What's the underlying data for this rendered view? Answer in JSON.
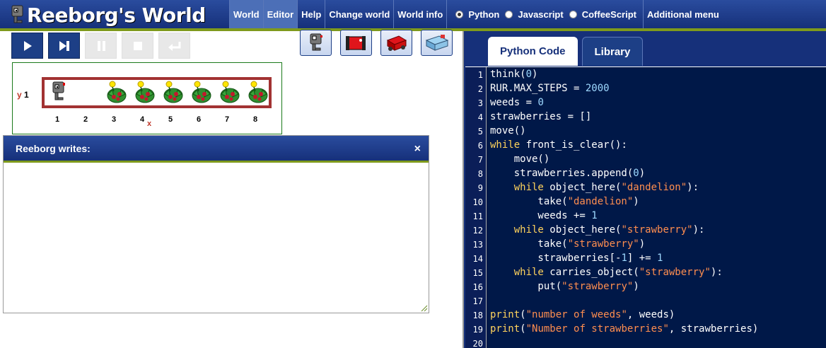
{
  "header": {
    "title": "Reeborg's World",
    "menu": [
      "World",
      "Editor",
      "Help",
      "Change world",
      "World info"
    ],
    "active_menu": [
      "World",
      "Editor"
    ],
    "languages": [
      "Python",
      "Javascript",
      "CoffeeScript"
    ],
    "selected_language": "Python",
    "additional_menu": "Additional menu"
  },
  "controls": {
    "run": "run-icon",
    "step": "step-icon",
    "pause": "pause-icon",
    "stop": "stop-icon",
    "reload": "reload-icon"
  },
  "robot_tools": [
    "robot-vertical-icon",
    "robot-red-icon",
    "robot-red-3d-icon",
    "robot-blue-3d-icon"
  ],
  "world": {
    "y_axis": "y",
    "y_values": [
      "1"
    ],
    "x_axis": "x",
    "x_values": [
      "1",
      "2",
      "3",
      "4",
      "5",
      "6",
      "7",
      "8"
    ],
    "cells": [
      {
        "x": 1,
        "content": "robot"
      },
      {
        "x": 2,
        "content": "empty"
      },
      {
        "x": 3,
        "content": "dandelion-strawberry"
      },
      {
        "x": 4,
        "content": "dandelion-strawberry"
      },
      {
        "x": 5,
        "content": "dandelion-strawberry"
      },
      {
        "x": 6,
        "content": "dandelion-strawberry"
      },
      {
        "x": 7,
        "content": "dandelion-strawberry"
      },
      {
        "x": 8,
        "content": "dandelion-strawberry"
      }
    ]
  },
  "dialog": {
    "title": "Reeborg writes:",
    "close": "×",
    "content": ""
  },
  "editor": {
    "tabs": [
      "Python Code",
      "Library"
    ],
    "active_tab": "Python Code",
    "line_numbers": [
      "1",
      "2",
      "3",
      "4",
      "5",
      "6",
      "7",
      "8",
      "9",
      "10",
      "11",
      "12",
      "13",
      "14",
      "15",
      "16",
      "17",
      "18",
      "19",
      "20"
    ],
    "lines": [
      "think(0)",
      "RUR.MAX_STEPS = 2000",
      "weeds = 0",
      "strawberries = []",
      "move()",
      "while front_is_clear():",
      "    move()",
      "    strawberries.append(0)",
      "    while object_here(\"dandelion\"):",
      "        take(\"dandelion\")",
      "        weeds += 1",
      "    while object_here(\"strawberry\"):",
      "        take(\"strawberry\")",
      "        strawberries[-1] += 1",
      "    while carries_object(\"strawberry\"):",
      "        put(\"strawberry\")",
      "",
      "print(\"number of weeds\", weeds)",
      "print(\"Number of strawberries\", strawberries)",
      ""
    ]
  },
  "colors": {
    "header_bg": "#16307a",
    "accent_green": "#7f9a1c",
    "wall_red": "#a23232",
    "editor_bg": "#001848",
    "keyword": "#ffd35c",
    "number": "#9ed9ff",
    "string": "#ff8e4f"
  }
}
